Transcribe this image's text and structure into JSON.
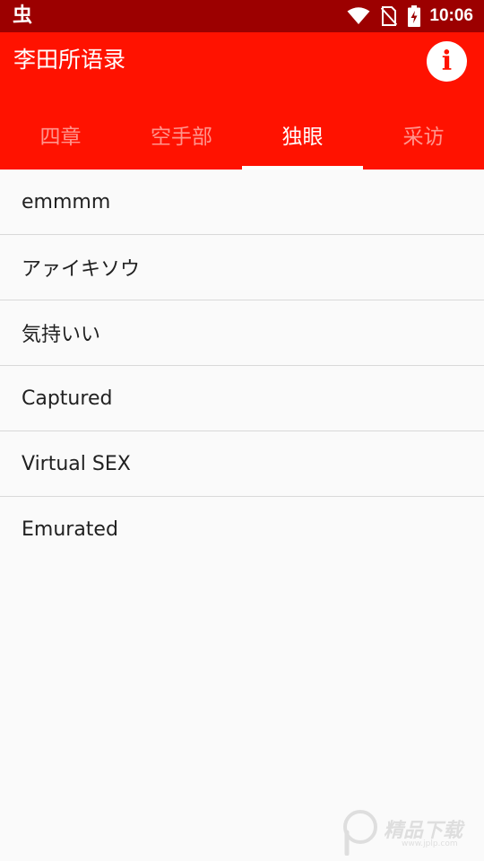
{
  "status_bar": {
    "app_icon_glyph": "虫",
    "time": "10:06",
    "background_color": "#9c0000",
    "icons": [
      "wifi-icon",
      "no-sim-icon",
      "battery-charging-icon"
    ]
  },
  "app_bar": {
    "title": "李田所语录",
    "info_icon_glyph": "i",
    "background_color": "#ff1200"
  },
  "tabs": [
    {
      "label": "四章",
      "active": false
    },
    {
      "label": "空手部",
      "active": false
    },
    {
      "label": "独眼",
      "active": true
    },
    {
      "label": "采访",
      "active": false
    }
  ],
  "list": {
    "items": [
      {
        "label": "emmmm"
      },
      {
        "label": "アァイキソウ"
      },
      {
        "label": "気持いい"
      },
      {
        "label": "Captured"
      },
      {
        "label": "Virtual SEX"
      },
      {
        "label": "Emurated"
      }
    ]
  },
  "watermark": {
    "text": "精品下载",
    "subtext": "www.jplp.com"
  }
}
